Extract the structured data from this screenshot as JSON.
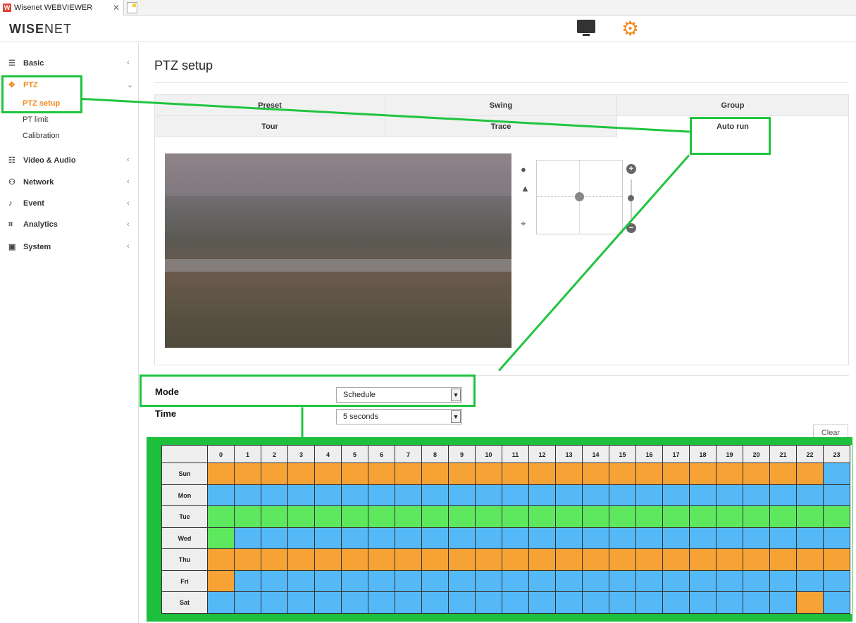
{
  "browser_tab": {
    "title": "Wisenet WEBVIEWER",
    "close": "✕"
  },
  "header": {
    "logo_bold": "WISE",
    "logo_rest": "NET"
  },
  "sidebar": {
    "items": [
      {
        "label": "Basic",
        "icon": "list-icon"
      },
      {
        "label": "PTZ",
        "icon": "move-icon",
        "sub": [
          "PTZ setup",
          "PT limit",
          "Calibration"
        ]
      },
      {
        "label": "Video & Audio",
        "icon": "sliders-icon"
      },
      {
        "label": "Network",
        "icon": "network-icon"
      },
      {
        "label": "Event",
        "icon": "bell-icon"
      },
      {
        "label": "Analytics",
        "icon": "analytics-icon"
      },
      {
        "label": "System",
        "icon": "system-icon"
      }
    ],
    "active_color": "#f08a1c"
  },
  "main": {
    "title": "PTZ setup",
    "tabs_row1": [
      "Preset",
      "Swing",
      "Group"
    ],
    "tabs_row2": [
      "Tour",
      "Trace",
      "Auto run"
    ],
    "mode_label": "Mode",
    "mode_value": "Schedule",
    "time_label": "Time",
    "time_value": "5 seconds",
    "clear_label": "Clear"
  },
  "schedule": {
    "hours": [
      "0",
      "1",
      "2",
      "3",
      "4",
      "5",
      "6",
      "7",
      "8",
      "9",
      "10",
      "11",
      "12",
      "13",
      "14",
      "15",
      "16",
      "17",
      "18",
      "19",
      "20",
      "21",
      "22",
      "23"
    ],
    "days": [
      "Sun",
      "Mon",
      "Tue",
      "Wed",
      "Thu",
      "Fri",
      "Sat"
    ],
    "colors": {
      "o": "#f7a234",
      "b": "#55b8f7",
      "g": "#5de85e"
    },
    "rows": [
      "ooooooooooooooooooooooob",
      "bbbbbbbbbbbbbbbbbbbbbbbb",
      "gggggggggggggggggggggggg",
      "gbbbbbbbbbbbbbbbbbbbbbbb",
      "oooooooooooooooooooooooo",
      "obbbbbbbbbbbbbbbbbbbbbbb",
      "bbbbbbbbbbbbbbbbbbbbbbob"
    ]
  }
}
